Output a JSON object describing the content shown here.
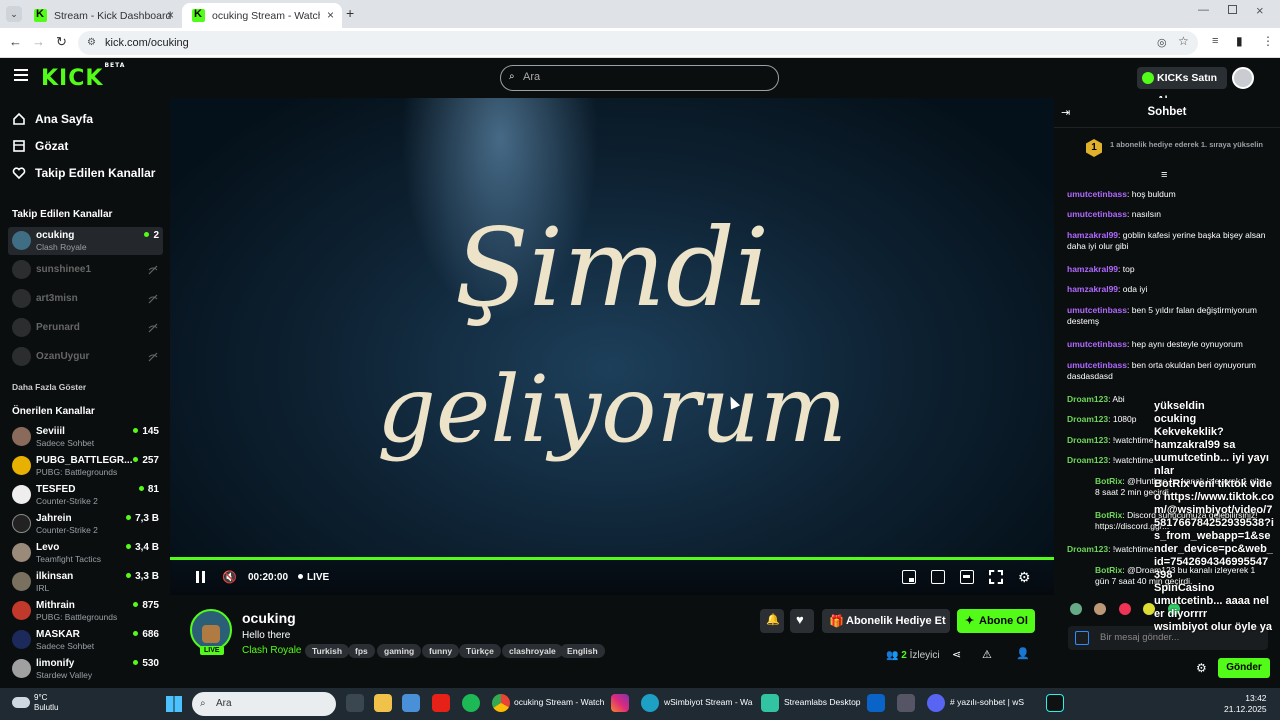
{
  "browser": {
    "tabs": [
      {
        "label": "Stream - Kick Dashboard"
      },
      {
        "label": "ocuking Stream - Watch Live or"
      }
    ],
    "url": "kick.com/ocuking"
  },
  "header": {
    "logo": "KICK",
    "logo_badge": "BETA",
    "search_placeholder": "Ara",
    "kicks_button": "KICKs Satın Al"
  },
  "sidebar": {
    "nav": [
      {
        "label": "Ana Sayfa",
        "icon": "home-icon"
      },
      {
        "label": "Gözat",
        "icon": "browse-icon"
      },
      {
        "label": "Takip Edilen Kanallar",
        "icon": "heart-icon"
      }
    ],
    "followed_heading": "Takip Edilen Kanallar",
    "followed": [
      {
        "name": "ocuking",
        "category": "Clash Royale",
        "viewers": "2",
        "live": true
      },
      {
        "name": "sunshinee1",
        "live": false
      },
      {
        "name": "art3misn",
        "live": false
      },
      {
        "name": "Perunard",
        "live": false
      },
      {
        "name": "OzanUygur",
        "live": false
      }
    ],
    "show_more": "Daha Fazla Göster",
    "recommended_heading": "Önerilen Kanallar",
    "recommended": [
      {
        "name": "Seviiil",
        "category": "Sadece Sohbet",
        "viewers": "145"
      },
      {
        "name": "PUBG_BATTLEGR...",
        "category": "PUBG: Battlegrounds",
        "viewers": "257"
      },
      {
        "name": "TESFED",
        "category": "Counter-Strike 2",
        "viewers": "81"
      },
      {
        "name": "Jahrein",
        "category": "Counter-Strike 2",
        "viewers": "7,3 B"
      },
      {
        "name": "Levo",
        "category": "Teamfight Tactics",
        "viewers": "3,4 B"
      },
      {
        "name": "ilkinsan",
        "category": "IRL",
        "viewers": "3,3 B"
      },
      {
        "name": "Mithrain",
        "category": "PUBG: Battlegrounds",
        "viewers": "875"
      },
      {
        "name": "MASKAR",
        "category": "Sadece Sohbet",
        "viewers": "686"
      },
      {
        "name": "limonify",
        "category": "Stardew Valley",
        "viewers": "530"
      }
    ]
  },
  "video": {
    "overlay_line1": "Şimdi",
    "overlay_line2": "geliyorum",
    "timecode": "00:20:00",
    "live_label": "LIVE",
    "progress": 1.0
  },
  "stream": {
    "channel": "ocuking",
    "title": "Hello there",
    "category": "Clash Royale",
    "live_badge": "LIVE",
    "tags": [
      "Turkish",
      "fps",
      "gaming",
      "funny",
      "Türkçe",
      "clashroyale",
      "English"
    ],
    "gift_button": "Abonelik Hediye Et",
    "subscribe_button": "Abone Ol",
    "viewers_count": "2",
    "viewers_label": "İzleyici"
  },
  "chat": {
    "title": "Sohbet",
    "pinned_rank": "1",
    "pinned": "1 abonelik hediye ederek 1. sıraya yükselin",
    "messages": [
      {
        "user": "umutcetinbass",
        "color": "purple",
        "text": "hoş buldum"
      },
      {
        "user": "umutcetinbass",
        "color": "purple",
        "text": "nasılsın"
      },
      {
        "user": "hamzakral99",
        "color": "purple",
        "text": "goblin kafesi yerine başka bişey alsan daha iyi olur gibi"
      },
      {
        "user": "hamzakral99",
        "color": "purple",
        "text": "top"
      },
      {
        "user": "hamzakral99",
        "color": "purple",
        "text": "oda iyi"
      },
      {
        "user": "umutcetinbass",
        "color": "purple",
        "text": "ben 5 yıldır falan değiştirmiyorum destemş"
      },
      {
        "user": "umutcetinbass",
        "color": "purple",
        "text": "hep aynı desteyle oynuyorum"
      },
      {
        "user": "umutcetinbass",
        "color": "purple",
        "text": "ben orta okuldan beri oynuyorum dasdasdasd"
      },
      {
        "user": "Droam123",
        "color": "green",
        "text": "Abi"
      },
      {
        "user": "Droam123",
        "color": "green",
        "text": "1080p"
      },
      {
        "user": "Droam123",
        "color": "green",
        "text": "!watchtime"
      },
      {
        "user": "Droam123",
        "color": "green",
        "text": "!watchtime"
      },
      {
        "user": "BotRix",
        "color": "green",
        "text": "@Huntime bu kanalı izleyerek 1 gün 8 saat 2 min geçirdi."
      },
      {
        "user": "BotRix",
        "color": "green",
        "text": "Discord sunucumuza gelebilirsiniz! https://discord.gg/..."
      },
      {
        "user": "Droam123",
        "color": "green",
        "text": "!watchtime"
      },
      {
        "user": "BotRix",
        "color": "green",
        "text": "@Droam123 bu kanalı izleyerek 1 gün 7 saat 40 min geçirdi."
      }
    ],
    "input_placeholder": "Bir mesaj gönder...",
    "send_button": "Gönder",
    "overlay_text": "yükseldin\nocuking\nKekvekeklik?\nhamzakral99 sa\nuumutcetinb... iyi yayınlar\nBotRix veni tiktok video https://www.tiktok.com/@wsimbiyot/video/7581766784252939538?is_from_webapp=1&sender_device=pc&web_id=7542694346995547398\nSpinCasino\numutcetinb... aaaa neler diyorrrr\nwsimbiyot olur öyle ya"
  },
  "taskbar": {
    "weather_temp": "9°C",
    "weather_desc": "Bulutlu",
    "search_placeholder": "Ara",
    "items": [
      "ocuking Stream - Watch",
      "wSimbiyot Stream - Wa",
      "Streamlabs Desktop",
      "# yazılı-sohbet | wS"
    ],
    "time": "13:42",
    "date": "21.12.2025"
  },
  "colors": {
    "brand_green": "#53fc18",
    "bg": "#0b0e0f",
    "chat_purple": "#b069ff"
  }
}
